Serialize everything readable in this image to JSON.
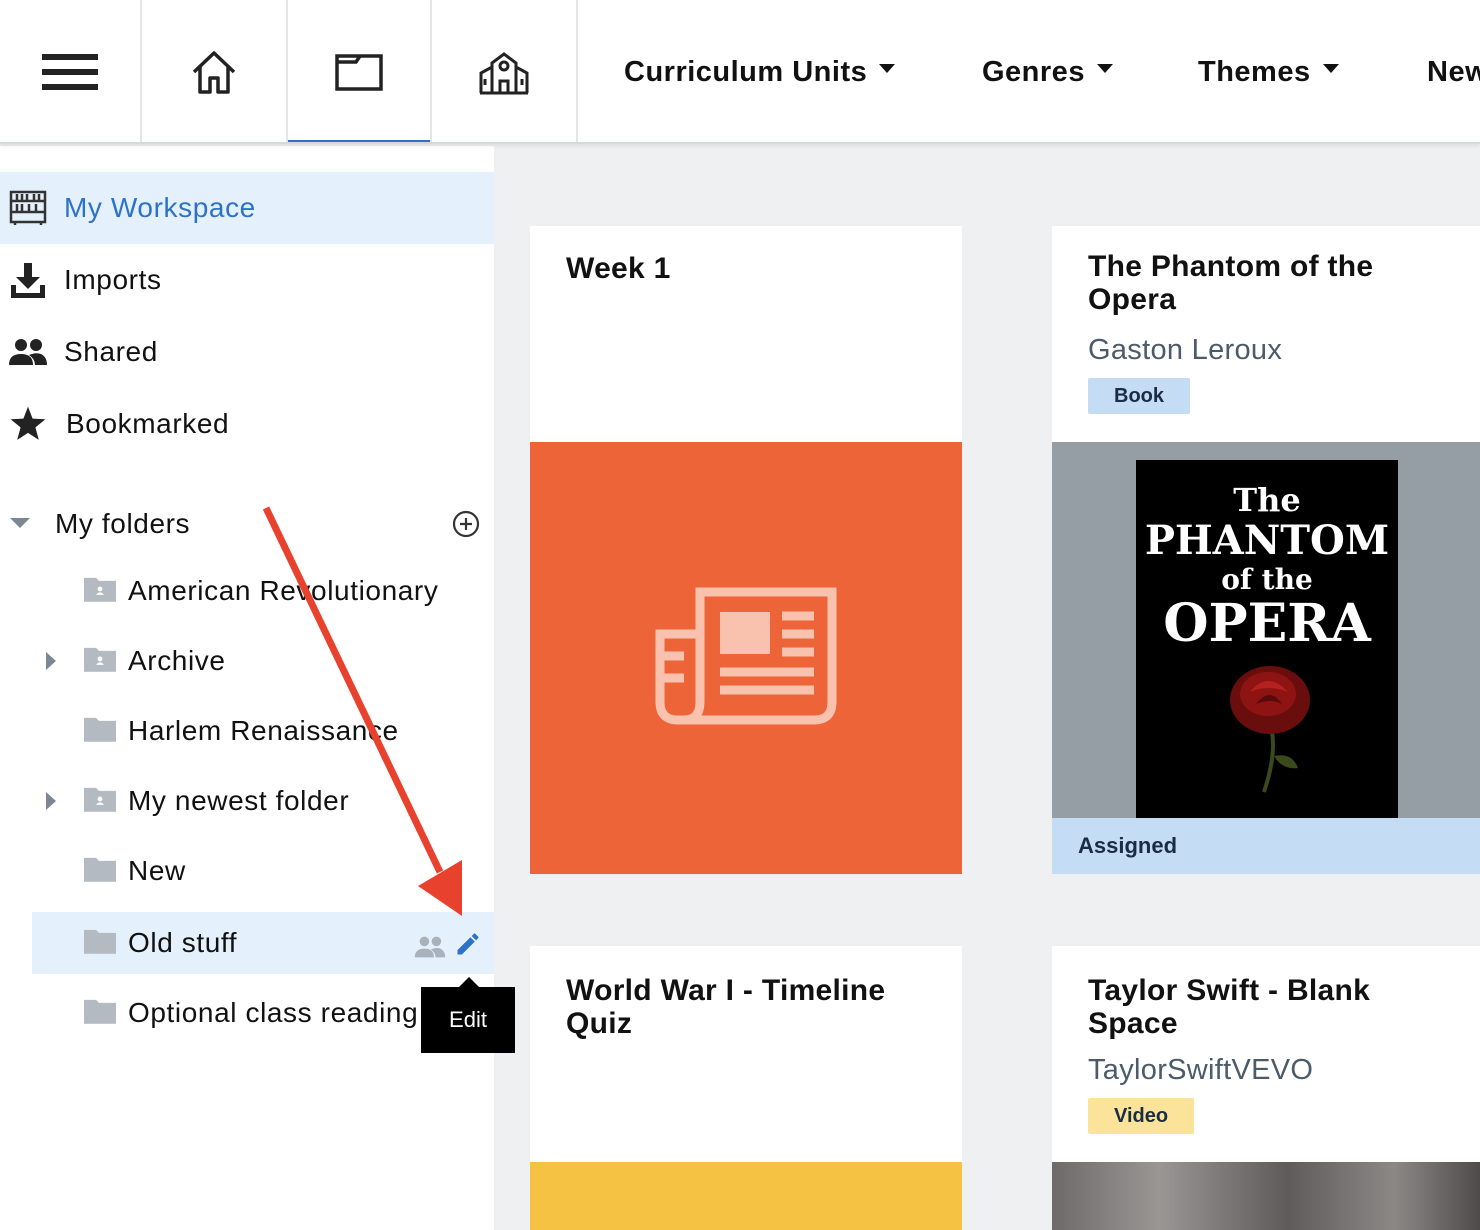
{
  "topnav": {
    "icons": [
      "hamburger-menu-icon",
      "home-icon",
      "folder-icon",
      "school-icon"
    ],
    "active_icon": "folder-icon",
    "menus": [
      {
        "label": "Curriculum Units"
      },
      {
        "label": "Genres"
      },
      {
        "label": "Themes"
      },
      {
        "label": "New"
      }
    ]
  },
  "sidebar": {
    "items": [
      {
        "label": "My Workspace",
        "icon": "workspace-icon",
        "active": true
      },
      {
        "label": "Imports",
        "icon": "download-icon",
        "active": false
      },
      {
        "label": "Shared",
        "icon": "people-icon",
        "active": false
      },
      {
        "label": "Bookmarked",
        "icon": "star-icon",
        "active": false
      }
    ],
    "folders_heading": "My folders",
    "folders": [
      {
        "label": "American Revolutionary",
        "shared": true,
        "expandable": false
      },
      {
        "label": "Archive",
        "shared": true,
        "expandable": true
      },
      {
        "label": "Harlem Renaissance",
        "shared": false,
        "expandable": false
      },
      {
        "label": "My newest folder",
        "shared": true,
        "expandable": true
      },
      {
        "label": "New",
        "shared": false,
        "expandable": false
      },
      {
        "label": "Old stuff",
        "shared": false,
        "expandable": false,
        "selected": true
      },
      {
        "label": "Optional class reading",
        "shared": false,
        "expandable": false
      }
    ],
    "tooltip": "Edit"
  },
  "cards": [
    {
      "title": "Week 1",
      "thumb_color": "#ed6439",
      "thumb_icon": "newspaper-icon"
    },
    {
      "title": "The Phantom of the Opera",
      "author": "Gaston Leroux",
      "badge": "Book",
      "badge_color": "#c5dcf5",
      "cover_lines": [
        "The",
        "PHANTOM",
        "of the",
        "OPERA"
      ],
      "status": "Assigned"
    },
    {
      "title": "World War I - Timeline Quiz",
      "thumb_color": "#f6c244"
    },
    {
      "title": "Taylor Swift - Blank Space",
      "author": "TaylorSwiftVEVO",
      "badge": "Video",
      "badge_color": "#fbe49a"
    }
  ],
  "colors": {
    "accent": "#2d72c8",
    "selected_bg": "#e4f1fd",
    "annotation_arrow": "#e8412e"
  }
}
